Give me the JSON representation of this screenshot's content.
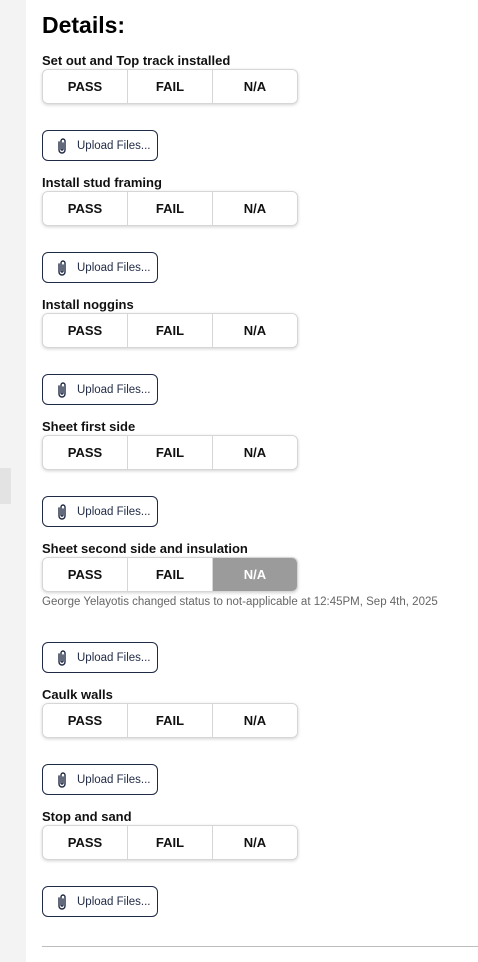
{
  "title": "Details:",
  "items": [
    {
      "label": "Set out and Top track installed",
      "pass": "PASS",
      "fail": "FAIL",
      "na": "N/A",
      "upload": "Upload Files...",
      "note": ""
    },
    {
      "label": "Install stud framing",
      "pass": "PASS",
      "fail": "FAIL",
      "na": "N/A",
      "upload": "Upload Files...",
      "note": ""
    },
    {
      "label": "Install noggins",
      "pass": "PASS",
      "fail": "FAIL",
      "na": "N/A",
      "upload": "Upload Files...",
      "note": ""
    },
    {
      "label": "Sheet first side",
      "pass": "PASS",
      "fail": "FAIL",
      "na": "N/A",
      "upload": "Upload Files...",
      "note": ""
    },
    {
      "label": "Sheet second side and insulation",
      "pass": "PASS",
      "fail": "FAIL",
      "na": "N/A",
      "upload": "Upload Files...",
      "selected": "N/A",
      "note": "George Yelayotis changed status to not-applicable at 12:45PM, Sep 4th, 2025"
    },
    {
      "label": "Caulk walls",
      "pass": "PASS",
      "fail": "FAIL",
      "na": "N/A",
      "upload": "Upload Files...",
      "note": ""
    },
    {
      "label": "Stop and sand",
      "pass": "PASS",
      "fail": "FAIL",
      "na": "N/A",
      "upload": "Upload Files...",
      "note": ""
    }
  ],
  "colors": {
    "selected_bg": "#9b9b9b",
    "upload_border": "#1f2a44"
  },
  "icons": {
    "upload": "paperclip-icon"
  }
}
